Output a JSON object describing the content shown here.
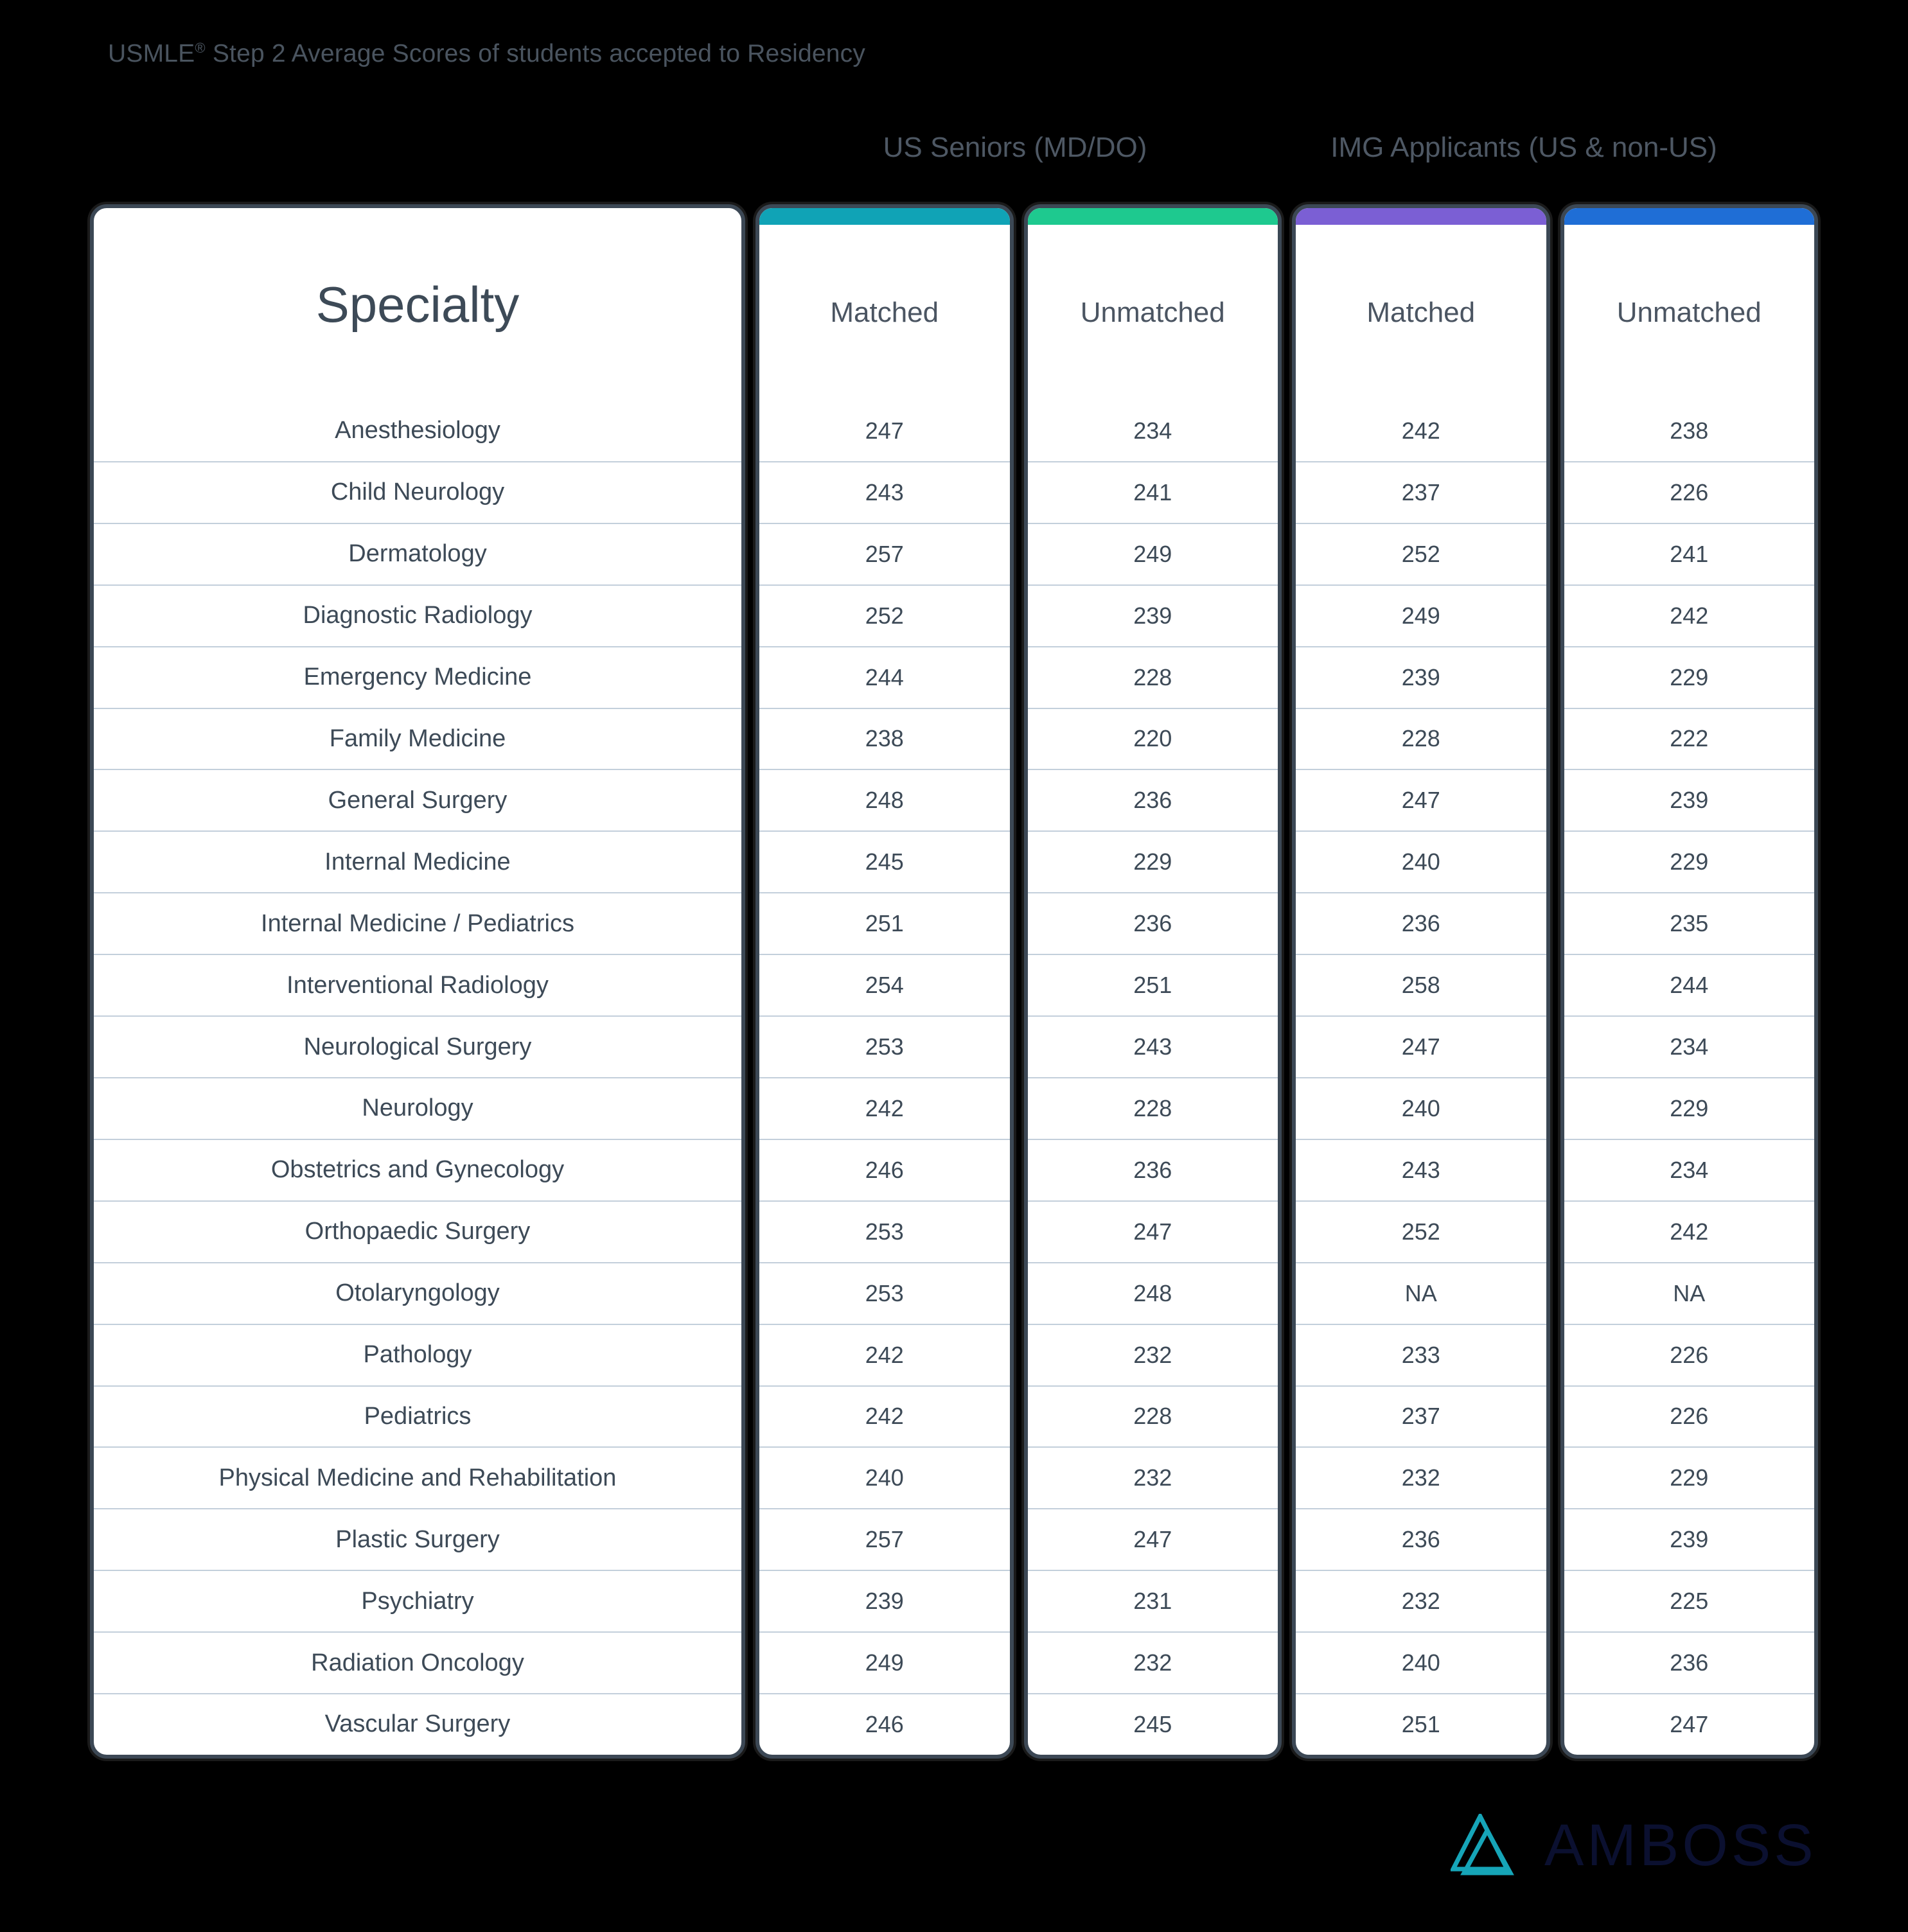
{
  "title": {
    "prefix": "USMLE",
    "trademark": "®",
    "rest": " Step 2 Average Scores of students accepted to Residency",
    "full": "USMLE® Step 2 Average Scores of students accepted to Residency"
  },
  "group_headers": {
    "us_seniors": "US Seniors (MD/DO)",
    "img_applicants": "IMG Applicants (US & non-US)"
  },
  "columns": [
    {
      "label": "Specialty",
      "accent": null
    },
    {
      "label": "Matched",
      "accent": "#10a3b6"
    },
    {
      "label": "Unmatched",
      "accent": "#1ec98f"
    },
    {
      "label": "Matched",
      "accent": "#7b5fd4"
    },
    {
      "label": "Unmatched",
      "accent": "#1f6ed6"
    }
  ],
  "colors": {
    "background": "#000000",
    "card_border": "#3c4855",
    "card_fill": "#ffffff",
    "row_divider": "#c3cfdb",
    "text": "#3d4a57",
    "title_text": "#4a545f",
    "accent_teal": "#10a3b6",
    "accent_green": "#1ec98f",
    "accent_purple": "#7b5fd4",
    "accent_blue": "#1f6ed6",
    "logo_mark": "#16a5b8",
    "logo_word": "#0b1030"
  },
  "logo": {
    "word": "AMBOSS",
    "mark": "amboss-triangle-logo"
  },
  "chart_data": {
    "type": "table",
    "title": "USMLE® Step 2 Average Scores of students accepted to Residency",
    "group_headers": [
      "",
      "US Seniors (MD/DO)",
      "IMG Applicants (US & non-US)"
    ],
    "columns": [
      "Specialty",
      "Matched",
      "Unmatched",
      "Matched",
      "Unmatched"
    ],
    "categories": [
      "Anesthesiology",
      "Child Neurology",
      "Dermatology",
      "Diagnostic Radiology",
      "Emergency Medicine",
      "Family Medicine",
      "General Surgery",
      "Internal Medicine",
      "Internal Medicine / Pediatrics",
      "Interventional Radiology",
      "Neurological Surgery",
      "Neurology",
      "Obstetrics and Gynecology",
      "Orthopaedic Surgery",
      "Otolaryngology",
      "Pathology",
      "Pediatrics",
      "Physical Medicine and Rehabilitation",
      "Plastic Surgery",
      "Psychiatry",
      "Radiation Oncology",
      "Vascular Surgery"
    ],
    "series": [
      {
        "name": "US Seniors Matched",
        "values": [
          247,
          243,
          257,
          252,
          244,
          238,
          248,
          245,
          251,
          254,
          253,
          242,
          246,
          253,
          253,
          242,
          242,
          240,
          257,
          239,
          249,
          246
        ]
      },
      {
        "name": "US Seniors Unmatched",
        "values": [
          234,
          241,
          249,
          239,
          228,
          220,
          236,
          229,
          236,
          251,
          243,
          228,
          236,
          247,
          248,
          232,
          228,
          232,
          247,
          231,
          232,
          245
        ]
      },
      {
        "name": "IMG Matched",
        "values": [
          242,
          237,
          252,
          249,
          239,
          228,
          247,
          240,
          236,
          258,
          247,
          240,
          243,
          252,
          "NA",
          233,
          237,
          232,
          236,
          232,
          240,
          251
        ]
      },
      {
        "name": "IMG Unmatched",
        "values": [
          238,
          226,
          241,
          242,
          229,
          222,
          239,
          229,
          235,
          244,
          234,
          229,
          234,
          242,
          "NA",
          226,
          226,
          229,
          239,
          225,
          236,
          247
        ]
      }
    ],
    "rows": [
      {
        "specialty": "Anesthesiology",
        "us_matched": "247",
        "us_unmatched": "234",
        "img_matched": "242",
        "img_unmatched": "238"
      },
      {
        "specialty": "Child Neurology",
        "us_matched": "243",
        "us_unmatched": "241",
        "img_matched": "237",
        "img_unmatched": "226"
      },
      {
        "specialty": "Dermatology",
        "us_matched": "257",
        "us_unmatched": "249",
        "img_matched": "252",
        "img_unmatched": "241"
      },
      {
        "specialty": "Diagnostic Radiology",
        "us_matched": "252",
        "us_unmatched": "239",
        "img_matched": "249",
        "img_unmatched": "242"
      },
      {
        "specialty": "Emergency Medicine",
        "us_matched": "244",
        "us_unmatched": "228",
        "img_matched": "239",
        "img_unmatched": "229"
      },
      {
        "specialty": "Family Medicine",
        "us_matched": "238",
        "us_unmatched": "220",
        "img_matched": "228",
        "img_unmatched": "222"
      },
      {
        "specialty": "General Surgery",
        "us_matched": "248",
        "us_unmatched": "236",
        "img_matched": "247",
        "img_unmatched": "239"
      },
      {
        "specialty": "Internal Medicine",
        "us_matched": "245",
        "us_unmatched": "229",
        "img_matched": "240",
        "img_unmatched": "229"
      },
      {
        "specialty": "Internal Medicine / Pediatrics",
        "us_matched": "251",
        "us_unmatched": "236",
        "img_matched": "236",
        "img_unmatched": "235"
      },
      {
        "specialty": "Interventional Radiology",
        "us_matched": "254",
        "us_unmatched": "251",
        "img_matched": "258",
        "img_unmatched": "244"
      },
      {
        "specialty": "Neurological Surgery",
        "us_matched": "253",
        "us_unmatched": "243",
        "img_matched": "247",
        "img_unmatched": "234"
      },
      {
        "specialty": "Neurology",
        "us_matched": "242",
        "us_unmatched": "228",
        "img_matched": "240",
        "img_unmatched": "229"
      },
      {
        "specialty": "Obstetrics and Gynecology",
        "us_matched": "246",
        "us_unmatched": "236",
        "img_matched": "243",
        "img_unmatched": "234"
      },
      {
        "specialty": "Orthopaedic Surgery",
        "us_matched": "253",
        "us_unmatched": "247",
        "img_matched": "252",
        "img_unmatched": "242"
      },
      {
        "specialty": "Otolaryngology",
        "us_matched": "253",
        "us_unmatched": "248",
        "img_matched": "NA",
        "img_unmatched": "NA"
      },
      {
        "specialty": "Pathology",
        "us_matched": "242",
        "us_unmatched": "232",
        "img_matched": "233",
        "img_unmatched": "226"
      },
      {
        "specialty": "Pediatrics",
        "us_matched": "242",
        "us_unmatched": "228",
        "img_matched": "237",
        "img_unmatched": "226"
      },
      {
        "specialty": "Physical Medicine and Rehabilitation",
        "us_matched": "240",
        "us_unmatched": "232",
        "img_matched": "232",
        "img_unmatched": "229"
      },
      {
        "specialty": "Plastic Surgery",
        "us_matched": "257",
        "us_unmatched": "247",
        "img_matched": "236",
        "img_unmatched": "239"
      },
      {
        "specialty": "Psychiatry",
        "us_matched": "239",
        "us_unmatched": "231",
        "img_matched": "232",
        "img_unmatched": "225"
      },
      {
        "specialty": "Radiation Oncology",
        "us_matched": "249",
        "us_unmatched": "232",
        "img_matched": "240",
        "img_unmatched": "236"
      },
      {
        "specialty": "Vascular Surgery",
        "us_matched": "246",
        "us_unmatched": "245",
        "img_matched": "251",
        "img_unmatched": "247"
      }
    ]
  }
}
